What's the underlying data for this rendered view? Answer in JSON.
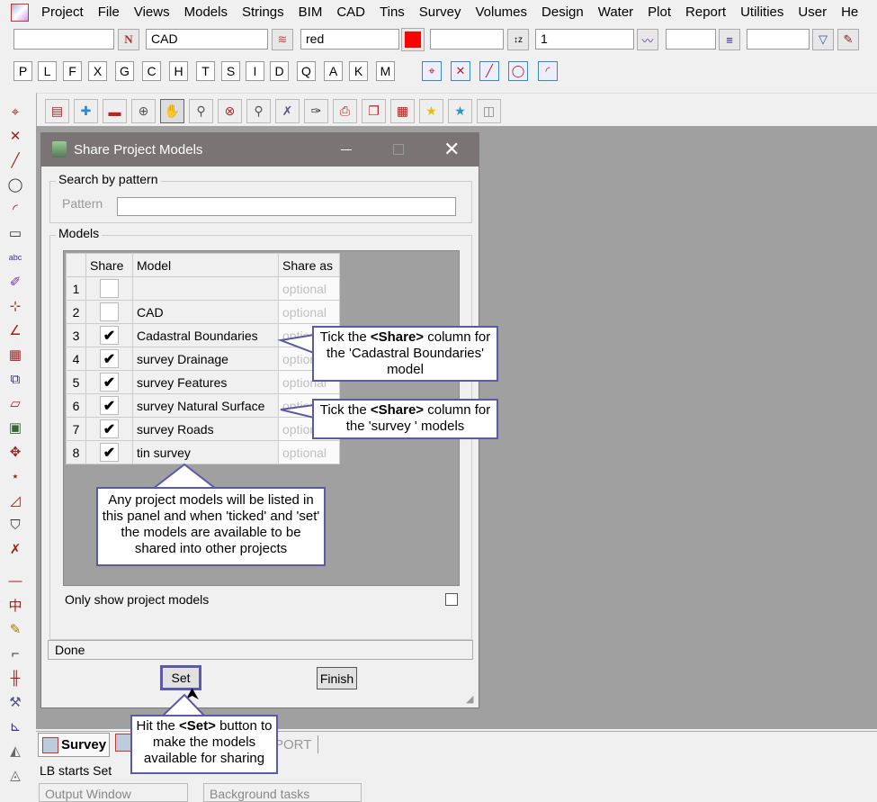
{
  "menu": [
    "Project",
    "File",
    "Views",
    "Models",
    "Strings",
    "BIM",
    "CAD",
    "Tins",
    "Survey",
    "Volumes",
    "Design",
    "Water",
    "Plot",
    "Report",
    "Utilities",
    "User",
    "He"
  ],
  "toolbar": {
    "name_value": "",
    "model_value": "CAD",
    "colour_value": "red",
    "colour_swatch": "#ff0000",
    "style_value": "",
    "weight_value": "1",
    "linestyle_value": "",
    "text_value": ""
  },
  "letters": [
    "P",
    "L",
    "F",
    "X",
    "G",
    "C",
    "H",
    "T",
    "S",
    "I",
    "D",
    "Q",
    "A",
    "K",
    "M"
  ],
  "dialog": {
    "title": "Share Project Models",
    "search_group": "Search by pattern",
    "pattern_label": "Pattern",
    "pattern_value": "",
    "models_group": "Models",
    "columns": [
      "Share",
      "Model",
      "Share as"
    ],
    "rows": [
      {
        "n": "1",
        "share": false,
        "model": "",
        "share_as": "optional"
      },
      {
        "n": "2",
        "share": false,
        "model": "CAD",
        "share_as": "optional"
      },
      {
        "n": "3",
        "share": true,
        "model": "Cadastral Boundaries",
        "share_as": "optional"
      },
      {
        "n": "4",
        "share": true,
        "model": "survey Drainage",
        "share_as": "optional"
      },
      {
        "n": "5",
        "share": true,
        "model": "survey Features",
        "share_as": "optional"
      },
      {
        "n": "6",
        "share": true,
        "model": "survey Natural Surface",
        "share_as": "optional"
      },
      {
        "n": "7",
        "share": true,
        "model": "survey Roads",
        "share_as": "optional"
      },
      {
        "n": "8",
        "share": true,
        "model": "tin survey",
        "share_as": "optional"
      }
    ],
    "only_show": "Only show project models",
    "status": "Done",
    "set": "Set",
    "finish": "Finish"
  },
  "callouts": {
    "c1": [
      "Tick the ",
      "<Share>",
      " column for the 'Cadastral Boundaries' model"
    ],
    "c2": [
      "Tick the ",
      "<Share>",
      " column for the 'survey ' models"
    ],
    "c3": "Any project models will be listed in this panel and when 'ticked' and 'set' the models are available to be shared into other projects",
    "c4": [
      "Hit the ",
      "<Set>",
      " button to make the models available for sharing"
    ]
  },
  "tabs": {
    "survey": "Survey",
    "report": "PORT"
  },
  "status_line": "LB starts Set",
  "panels": {
    "output": "Output Window",
    "background": "Background tasks"
  },
  "accent": "#5a5aa8"
}
